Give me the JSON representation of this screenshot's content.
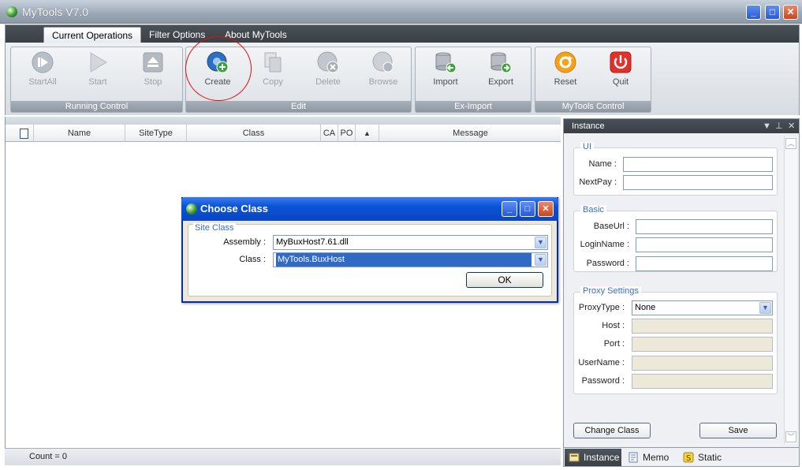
{
  "window": {
    "title": "MyTools V7.0",
    "minimize": "_",
    "maximize": "□",
    "close": "✕"
  },
  "tabs": [
    {
      "label": "Current Operations",
      "active": true
    },
    {
      "label": "Filter Options",
      "active": false
    },
    {
      "label": "About MyTools",
      "active": false
    }
  ],
  "ribbon": {
    "groups": [
      {
        "caption": "Running Control",
        "buttons": [
          {
            "label": "StartAll",
            "icon": "start-all-icon",
            "enabled": false
          },
          {
            "label": "Start",
            "icon": "play-icon",
            "enabled": false
          },
          {
            "label": "Stop",
            "icon": "stop-icon",
            "enabled": false
          }
        ]
      },
      {
        "caption": "Edit",
        "buttons": [
          {
            "label": "Create",
            "icon": "create-icon",
            "enabled": true
          },
          {
            "label": "Copy",
            "icon": "copy-icon",
            "enabled": false
          },
          {
            "label": "Delete",
            "icon": "delete-icon",
            "enabled": false
          },
          {
            "label": "Browse",
            "icon": "browse-icon",
            "enabled": false
          }
        ]
      },
      {
        "caption": "Ex-Import",
        "buttons": [
          {
            "label": "Import",
            "icon": "import-icon",
            "enabled": true
          },
          {
            "label": "Export",
            "icon": "export-icon",
            "enabled": true
          }
        ]
      },
      {
        "caption": "MyTools Control",
        "buttons": [
          {
            "label": "Reset",
            "icon": "reset-icon",
            "enabled": true
          },
          {
            "label": "Quit",
            "icon": "power-icon",
            "enabled": true
          }
        ]
      }
    ]
  },
  "grid": {
    "columns": [
      "Name",
      "SiteType",
      "Class",
      "CA",
      "PO",
      "▲",
      "Message"
    ],
    "rows": []
  },
  "status": {
    "count_text": "Count = 0"
  },
  "panel": {
    "title": "Instance",
    "controls": [
      "▼",
      "⊥",
      "✕"
    ],
    "sections": {
      "ui": {
        "legend": "UI",
        "name_label": "Name :",
        "name_value": "",
        "nextpay_label": "NextPay :",
        "nextpay_value": ""
      },
      "basic": {
        "legend": "Basic",
        "baseurl_label": "BaseUrl :",
        "loginname_label": "LoginName :",
        "password_label": "Password :"
      },
      "proxy": {
        "legend": "Proxy Settings",
        "proxytype_label": "ProxyType :",
        "proxytype_value": "None",
        "host_label": "Host :",
        "port_label": "Port :",
        "username_label": "UserName :",
        "password_label": "Password :"
      }
    },
    "change_class_label": "Change Class",
    "save_label": "Save",
    "tabs": [
      {
        "label": "Instance",
        "icon": "instance-icon",
        "active": true
      },
      {
        "label": "Memo",
        "icon": "memo-icon",
        "active": false
      },
      {
        "label": "Static",
        "icon": "static-icon",
        "active": false
      }
    ]
  },
  "dialog": {
    "title": "Choose Class",
    "legend": "Site Class",
    "assembly_label": "Assembly :",
    "assembly_value": "MyBuxHost7.61.dll",
    "class_label": "Class :",
    "class_value": "MyTools.BuxHost",
    "ok_label": "OK"
  },
  "colors": {
    "accent_blue": "#0a52d6",
    "highlight_red": "#dd1111",
    "selection": "#316ac5"
  }
}
